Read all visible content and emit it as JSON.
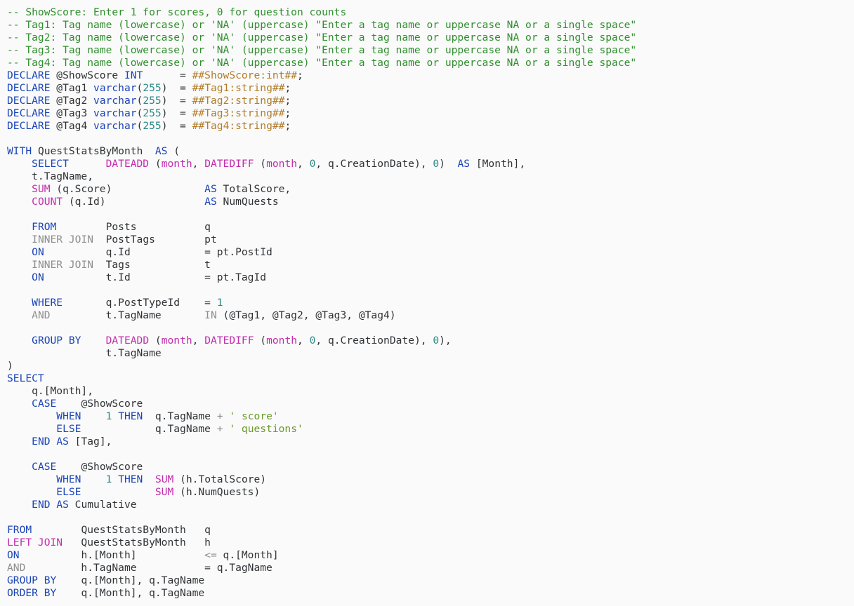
{
  "colors": {
    "background": "#fafafa",
    "comment": "#318f2f",
    "keyword": "#1a44b8",
    "function": "#c32cae",
    "gray": "#8e8e8e",
    "plain": "#303336",
    "number": "#2b8a88",
    "string": "#6a9a2c",
    "parameter": "#b27d2a"
  },
  "code_lines": [
    [
      [
        "comment",
        "-- ShowScore: Enter 1 for scores, 0 for question counts"
      ]
    ],
    [
      [
        "comment",
        "-- Tag1: Tag name (lowercase) or 'NA' (uppercase) \"Enter a tag name or uppercase NA or a single space\""
      ]
    ],
    [
      [
        "comment",
        "-- Tag2: Tag name (lowercase) or 'NA' (uppercase) \"Enter a tag name or uppercase NA or a single space\""
      ]
    ],
    [
      [
        "comment",
        "-- Tag3: Tag name (lowercase) or 'NA' (uppercase) \"Enter a tag name or uppercase NA or a single space\""
      ]
    ],
    [
      [
        "comment",
        "-- Tag4: Tag name (lowercase) or 'NA' (uppercase) \"Enter a tag name or uppercase NA or a single space\""
      ]
    ],
    [
      [
        "keyword",
        "DECLARE"
      ],
      [
        "plain",
        " @ShowScore "
      ],
      [
        "keyword",
        "INT"
      ],
      [
        "plain",
        "      = "
      ],
      [
        "param",
        "##ShowScore:int##"
      ],
      [
        "plain",
        ";"
      ]
    ],
    [
      [
        "keyword",
        "DECLARE"
      ],
      [
        "plain",
        " @Tag1 "
      ],
      [
        "keyword",
        "varchar"
      ],
      [
        "plain",
        "("
      ],
      [
        "number",
        "255"
      ],
      [
        "plain",
        ")  = "
      ],
      [
        "param",
        "##Tag1:string##"
      ],
      [
        "plain",
        ";"
      ]
    ],
    [
      [
        "keyword",
        "DECLARE"
      ],
      [
        "plain",
        " @Tag2 "
      ],
      [
        "keyword",
        "varchar"
      ],
      [
        "plain",
        "("
      ],
      [
        "number",
        "255"
      ],
      [
        "plain",
        ")  = "
      ],
      [
        "param",
        "##Tag2:string##"
      ],
      [
        "plain",
        ";"
      ]
    ],
    [
      [
        "keyword",
        "DECLARE"
      ],
      [
        "plain",
        " @Tag3 "
      ],
      [
        "keyword",
        "varchar"
      ],
      [
        "plain",
        "("
      ],
      [
        "number",
        "255"
      ],
      [
        "plain",
        ")  = "
      ],
      [
        "param",
        "##Tag3:string##"
      ],
      [
        "plain",
        ";"
      ]
    ],
    [
      [
        "keyword",
        "DECLARE"
      ],
      [
        "plain",
        " @Tag4 "
      ],
      [
        "keyword",
        "varchar"
      ],
      [
        "plain",
        "("
      ],
      [
        "number",
        "255"
      ],
      [
        "plain",
        ")  = "
      ],
      [
        "param",
        "##Tag4:string##"
      ],
      [
        "plain",
        ";"
      ]
    ],
    [],
    [
      [
        "keyword",
        "WITH"
      ],
      [
        "plain",
        " QuestStatsByMonth  "
      ],
      [
        "keyword",
        "AS"
      ],
      [
        "plain",
        " ("
      ]
    ],
    [
      [
        "plain",
        "    "
      ],
      [
        "keyword",
        "SELECT"
      ],
      [
        "plain",
        "      "
      ],
      [
        "func",
        "DATEADD"
      ],
      [
        "plain",
        " ("
      ],
      [
        "func",
        "month"
      ],
      [
        "plain",
        ", "
      ],
      [
        "func",
        "DATEDIFF"
      ],
      [
        "plain",
        " ("
      ],
      [
        "func",
        "month"
      ],
      [
        "plain",
        ", "
      ],
      [
        "number",
        "0"
      ],
      [
        "plain",
        ", q.CreationDate), "
      ],
      [
        "number",
        "0"
      ],
      [
        "plain",
        ")  "
      ],
      [
        "keyword",
        "AS"
      ],
      [
        "plain",
        " [Month],"
      ]
    ],
    [
      [
        "plain",
        "    t.TagName,"
      ]
    ],
    [
      [
        "plain",
        "    "
      ],
      [
        "func",
        "SUM"
      ],
      [
        "plain",
        " (q.Score)               "
      ],
      [
        "keyword",
        "AS"
      ],
      [
        "plain",
        " TotalScore,"
      ]
    ],
    [
      [
        "plain",
        "    "
      ],
      [
        "func",
        "COUNT"
      ],
      [
        "plain",
        " (q.Id)                "
      ],
      [
        "keyword",
        "AS"
      ],
      [
        "plain",
        " NumQuests"
      ]
    ],
    [],
    [
      [
        "plain",
        "    "
      ],
      [
        "keyword",
        "FROM"
      ],
      [
        "plain",
        "        Posts           q"
      ]
    ],
    [
      [
        "plain",
        "    "
      ],
      [
        "gray",
        "INNER JOIN"
      ],
      [
        "plain",
        "  PostTags        pt"
      ]
    ],
    [
      [
        "plain",
        "    "
      ],
      [
        "keyword",
        "ON"
      ],
      [
        "plain",
        "          q.Id            = pt.PostId"
      ]
    ],
    [
      [
        "plain",
        "    "
      ],
      [
        "gray",
        "INNER JOIN"
      ],
      [
        "plain",
        "  Tags            t"
      ]
    ],
    [
      [
        "plain",
        "    "
      ],
      [
        "keyword",
        "ON"
      ],
      [
        "plain",
        "          t.Id            = pt.TagId"
      ]
    ],
    [],
    [
      [
        "plain",
        "    "
      ],
      [
        "keyword",
        "WHERE"
      ],
      [
        "plain",
        "       q.PostTypeId    = "
      ],
      [
        "number",
        "1"
      ]
    ],
    [
      [
        "plain",
        "    "
      ],
      [
        "gray",
        "AND"
      ],
      [
        "plain",
        "         t.TagName       "
      ],
      [
        "gray",
        "IN"
      ],
      [
        "plain",
        " (@Tag1, @Tag2, @Tag3, @Tag4)"
      ]
    ],
    [],
    [
      [
        "plain",
        "    "
      ],
      [
        "keyword",
        "GROUP BY"
      ],
      [
        "plain",
        "    "
      ],
      [
        "func",
        "DATEADD"
      ],
      [
        "plain",
        " ("
      ],
      [
        "func",
        "month"
      ],
      [
        "plain",
        ", "
      ],
      [
        "func",
        "DATEDIFF"
      ],
      [
        "plain",
        " ("
      ],
      [
        "func",
        "month"
      ],
      [
        "plain",
        ", "
      ],
      [
        "number",
        "0"
      ],
      [
        "plain",
        ", q.CreationDate), "
      ],
      [
        "number",
        "0"
      ],
      [
        "plain",
        "),"
      ]
    ],
    [
      [
        "plain",
        "                t.TagName"
      ]
    ],
    [
      [
        "plain",
        ")"
      ]
    ],
    [
      [
        "keyword",
        "SELECT"
      ]
    ],
    [
      [
        "plain",
        "    q.[Month],"
      ]
    ],
    [
      [
        "plain",
        "    "
      ],
      [
        "keyword",
        "CASE"
      ],
      [
        "plain",
        "    @ShowScore"
      ]
    ],
    [
      [
        "plain",
        "        "
      ],
      [
        "keyword",
        "WHEN"
      ],
      [
        "plain",
        "    "
      ],
      [
        "number",
        "1"
      ],
      [
        "plain",
        " "
      ],
      [
        "keyword",
        "THEN"
      ],
      [
        "plain",
        "  q.TagName "
      ],
      [
        "gray",
        "+"
      ],
      [
        "plain",
        " "
      ],
      [
        "string",
        "' score'"
      ]
    ],
    [
      [
        "plain",
        "        "
      ],
      [
        "keyword",
        "ELSE"
      ],
      [
        "plain",
        "            q.TagName "
      ],
      [
        "gray",
        "+"
      ],
      [
        "plain",
        " "
      ],
      [
        "string",
        "' questions'"
      ]
    ],
    [
      [
        "plain",
        "    "
      ],
      [
        "keyword",
        "END"
      ],
      [
        "plain",
        " "
      ],
      [
        "keyword",
        "AS"
      ],
      [
        "plain",
        " [Tag],"
      ]
    ],
    [],
    [
      [
        "plain",
        "    "
      ],
      [
        "keyword",
        "CASE"
      ],
      [
        "plain",
        "    @ShowScore"
      ]
    ],
    [
      [
        "plain",
        "        "
      ],
      [
        "keyword",
        "WHEN"
      ],
      [
        "plain",
        "    "
      ],
      [
        "number",
        "1"
      ],
      [
        "plain",
        " "
      ],
      [
        "keyword",
        "THEN"
      ],
      [
        "plain",
        "  "
      ],
      [
        "func",
        "SUM"
      ],
      [
        "plain",
        " (h.TotalScore)"
      ]
    ],
    [
      [
        "plain",
        "        "
      ],
      [
        "keyword",
        "ELSE"
      ],
      [
        "plain",
        "            "
      ],
      [
        "func",
        "SUM"
      ],
      [
        "plain",
        " (h.NumQuests)"
      ]
    ],
    [
      [
        "plain",
        "    "
      ],
      [
        "keyword",
        "END"
      ],
      [
        "plain",
        " "
      ],
      [
        "keyword",
        "AS"
      ],
      [
        "plain",
        " Cumulative"
      ]
    ],
    [],
    [
      [
        "keyword",
        "FROM"
      ],
      [
        "plain",
        "        QuestStatsByMonth   q"
      ]
    ],
    [
      [
        "func",
        "LEFT JOIN"
      ],
      [
        "plain",
        "   QuestStatsByMonth   h"
      ]
    ],
    [
      [
        "keyword",
        "ON"
      ],
      [
        "plain",
        "          h.[Month]           "
      ],
      [
        "gray",
        "<="
      ],
      [
        "plain",
        " q.[Month]"
      ]
    ],
    [
      [
        "gray",
        "AND"
      ],
      [
        "plain",
        "         h.TagName           = q.TagName"
      ]
    ],
    [
      [
        "keyword",
        "GROUP BY"
      ],
      [
        "plain",
        "    q.[Month], q.TagName"
      ]
    ],
    [
      [
        "keyword",
        "ORDER BY"
      ],
      [
        "plain",
        "    q.[Month], q.TagName"
      ]
    ]
  ]
}
